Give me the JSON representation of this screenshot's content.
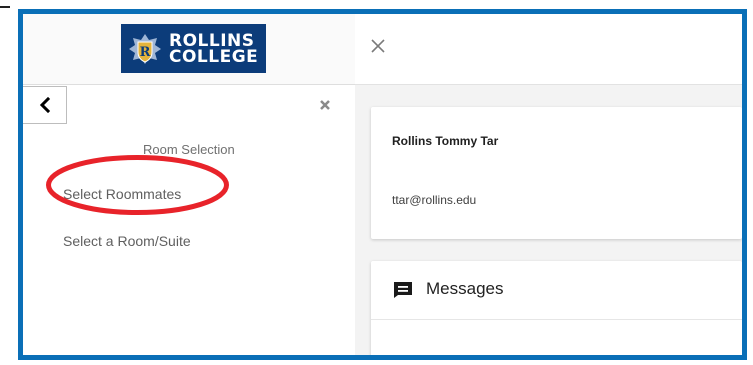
{
  "logo": {
    "line1": "ROLLINS",
    "line2": "COLLEGE"
  },
  "sidebar": {
    "section_title": "Room Selection",
    "items": [
      {
        "label": "Select Roommates",
        "highlighted": true
      },
      {
        "label": "Select a Room/Suite",
        "highlighted": false
      }
    ]
  },
  "user": {
    "name": "Rollins Tommy Tar",
    "email": "ttar@rollins.edu"
  },
  "messages": {
    "title": "Messages"
  },
  "icons": {
    "back": "chevron-left-icon",
    "collapse": "close-icon",
    "close": "close-icon",
    "messages": "message-icon"
  },
  "colors": {
    "frame_border": "#0a6fb7",
    "logo_bg": "#0c3c7a",
    "highlight_circle": "#e8232a",
    "content_bg": "#f3f3f3"
  }
}
